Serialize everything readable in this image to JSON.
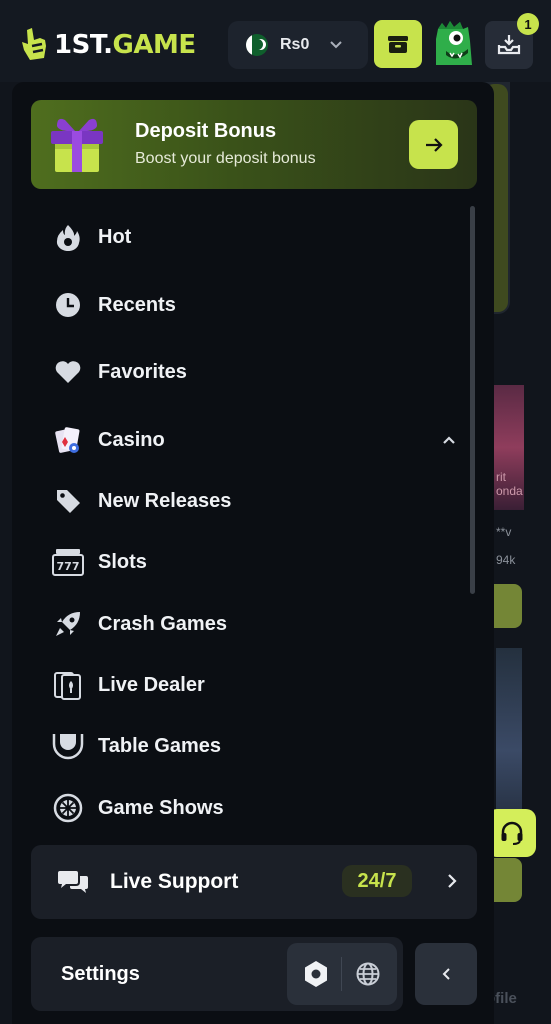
{
  "header": {
    "logo": {
      "prefix": "1ST.",
      "suffix": "GAME"
    },
    "currency": {
      "value": "Rs0"
    },
    "inbox_badge": "1",
    "colors": {
      "accent": "#c7e34c",
      "background": "#141921"
    }
  },
  "promo": {
    "title": "Deposit Bonus",
    "subtitle": "Boost your deposit bonus",
    "icon": "gift-icon"
  },
  "menu": {
    "items": [
      {
        "label": "Hot",
        "icon": "fire-icon"
      },
      {
        "label": "Recents",
        "icon": "clock-icon"
      },
      {
        "label": "Favorites",
        "icon": "heart-icon"
      },
      {
        "label": "Casino",
        "icon": "casino-cards-icon",
        "expanded": true
      },
      {
        "label": "New Releases",
        "icon": "tag-icon"
      },
      {
        "label": "Slots",
        "icon": "slot-machine-icon"
      },
      {
        "label": "Crash Games",
        "icon": "rocket-icon"
      },
      {
        "label": "Live Dealer",
        "icon": "playing-cards-icon"
      },
      {
        "label": "Table Games",
        "icon": "table-icon"
      },
      {
        "label": "Game Shows",
        "icon": "wheel-icon"
      }
    ]
  },
  "support": {
    "label": "Live Support",
    "badge": "24/7"
  },
  "settings": {
    "label": "Settings"
  },
  "background": {
    "profile_label": "ofile",
    "stats": [
      "**v",
      "94k"
    ],
    "game_text": "rit\nonda"
  }
}
